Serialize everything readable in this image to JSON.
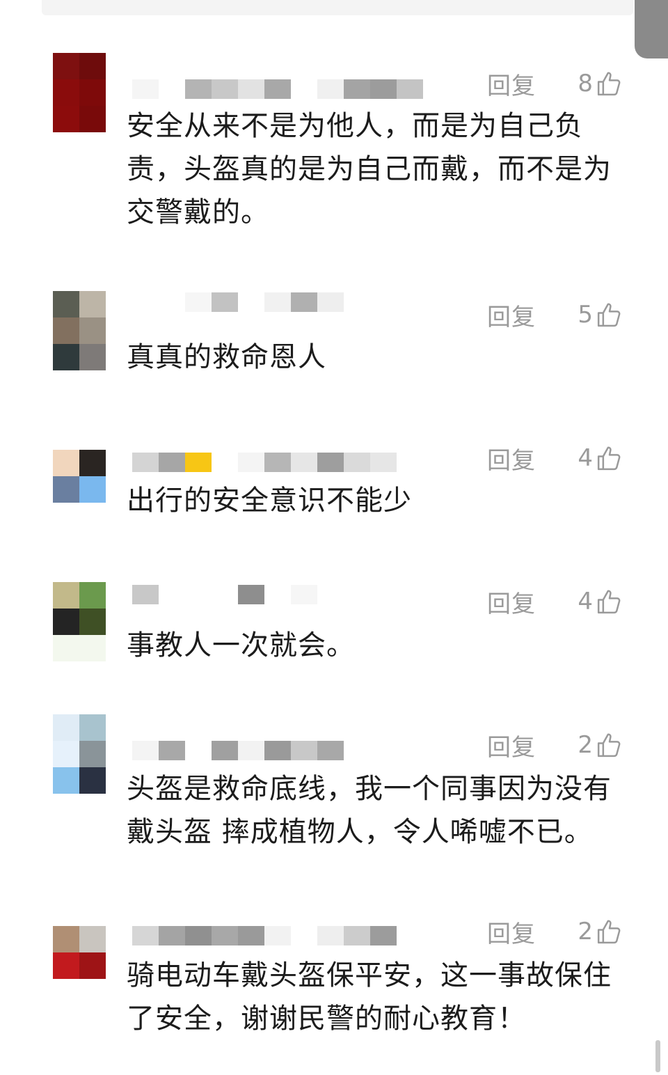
{
  "reply_label": "回复",
  "comments": [
    {
      "text": "安全从来不是为他人，而是为自己负责，头盔真的是为自己而戴，而不是为交警戴的。",
      "likes": "8",
      "avatar_colors": [
        "#7e1010",
        "#6e0c0c",
        "#8a0c0c",
        "#7e0a0a",
        "#8c0c0c",
        "#790a0a"
      ]
    },
    {
      "text": "真真的救命恩人",
      "likes": "5",
      "avatar_colors": [
        "#5b5e53",
        "#bdb5a7",
        "#82705f",
        "#9a9184",
        "#2f3a3c",
        "#7e7a78"
      ]
    },
    {
      "text": "出行的安全意识不能少",
      "likes": "4",
      "avatar_colors": [
        "#f1d6bd",
        "#2a2522",
        "#6a7fa0",
        "#7ab8ee"
      ]
    },
    {
      "text": "事教人一次就会。",
      "likes": "4",
      "avatar_colors": [
        "#c2b98a",
        "#6b9a4d",
        "#242424",
        "#3f5025",
        "#f3f8ee",
        "#f3f8ee"
      ]
    },
    {
      "text": "头盔是救命底线，我一个同事因为没有戴头盔 摔成植物人，令人唏嘘不已。",
      "likes": "2",
      "avatar_colors": [
        "#e0ecf6",
        "#a8c3ce",
        "#e6f1fb",
        "#8a9499",
        "#88c2ec",
        "#2a3142"
      ]
    },
    {
      "text": "骑电动车戴头盔保平安，这一事故保住了安全，谢谢民警的耐心教育！",
      "likes": "2",
      "avatar_colors": [
        "#b08f74",
        "#c9c5bf",
        "#c21a1e",
        "#9e1416"
      ]
    }
  ]
}
